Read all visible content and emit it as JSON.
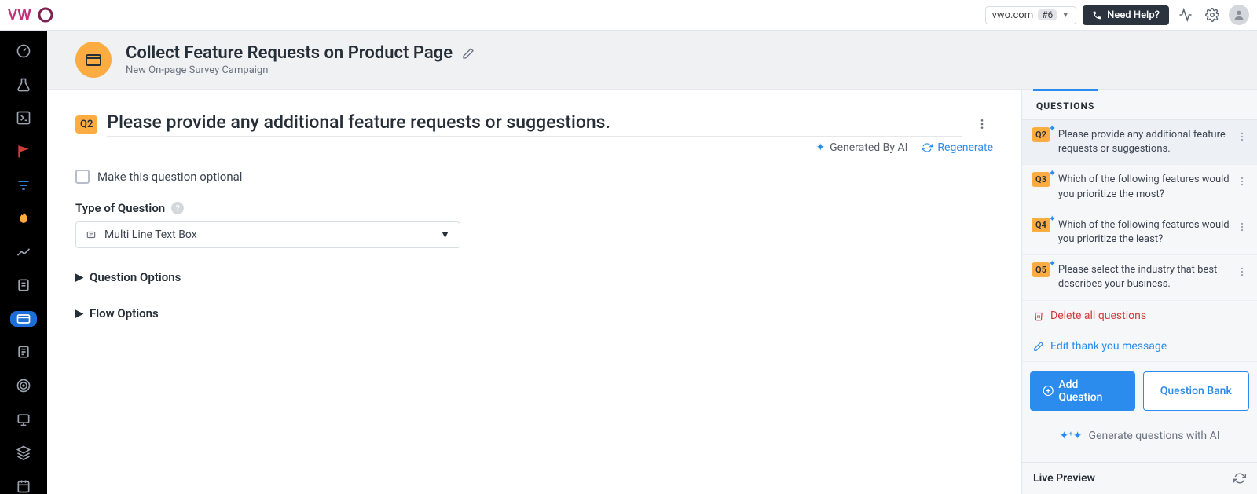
{
  "topbar": {
    "domain": "vwo.com",
    "domain_badge": "#6",
    "need_help": "Need Help?"
  },
  "header": {
    "title": "Collect Feature Requests on Product Page",
    "subtitle": "New On-page Survey Campaign"
  },
  "editor": {
    "question_number": "Q2",
    "question_text": "Please provide any additional feature requests or suggestions.",
    "ai_label": "Generated By AI",
    "regenerate": "Regenerate",
    "optional_label": "Make this question optional",
    "type_label": "Type of Question",
    "type_value": "Multi Line Text Box",
    "question_options": "Question Options",
    "flow_options": "Flow Options"
  },
  "right": {
    "tab": "QUESTIONS",
    "questions": [
      {
        "num": "Q2",
        "text": "Please provide any additional feature requests or suggestions.",
        "active": true
      },
      {
        "num": "Q3",
        "text": "Which of the following features would you prioritize the most?",
        "active": false
      },
      {
        "num": "Q4",
        "text": "Which of the following features would you prioritize the least?",
        "active": false
      },
      {
        "num": "Q5",
        "text": "Please select the industry that best describes your business.",
        "active": false
      }
    ],
    "delete_all": "Delete all questions",
    "edit_thank_you": "Edit thank you message",
    "add_question": "Add Question",
    "question_bank": "Question Bank",
    "generate_ai": "Generate questions with AI",
    "live_preview": "Live Preview"
  }
}
